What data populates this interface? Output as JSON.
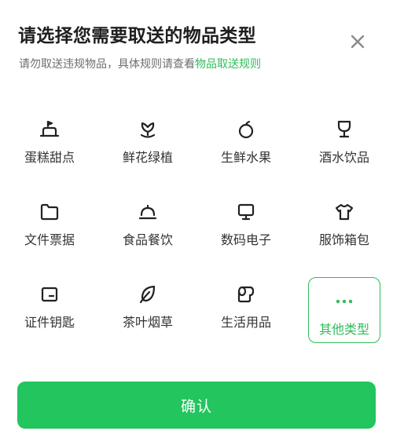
{
  "header": {
    "title": "请选择您需要取送的物品类型",
    "subtitle_text": "请勿取送违规物品，具体规则请查看",
    "rules_link": "物品取送规则"
  },
  "categories": [
    {
      "label": "蛋糕甜点",
      "icon": "cake-icon"
    },
    {
      "label": "鲜花绿植",
      "icon": "flower-icon"
    },
    {
      "label": "生鲜水果",
      "icon": "apple-icon"
    },
    {
      "label": "酒水饮品",
      "icon": "wine-glass-icon"
    },
    {
      "label": "文件票据",
      "icon": "folder-icon"
    },
    {
      "label": "食品餐饮",
      "icon": "food-cloche-icon"
    },
    {
      "label": "数码电子",
      "icon": "monitor-icon"
    },
    {
      "label": "服饰箱包",
      "icon": "tshirt-icon"
    },
    {
      "label": "证件钥匙",
      "icon": "id-card-icon"
    },
    {
      "label": "茶叶烟草",
      "icon": "leaf-icon"
    },
    {
      "label": "生活用品",
      "icon": "toilet-paper-icon"
    },
    {
      "label": "其他类型",
      "icon": "more-dots-icon",
      "selected": true
    }
  ],
  "confirm_label": "确认",
  "colors": {
    "accent": "#22c55e",
    "link": "#2ebd58",
    "icon": "#222222"
  }
}
